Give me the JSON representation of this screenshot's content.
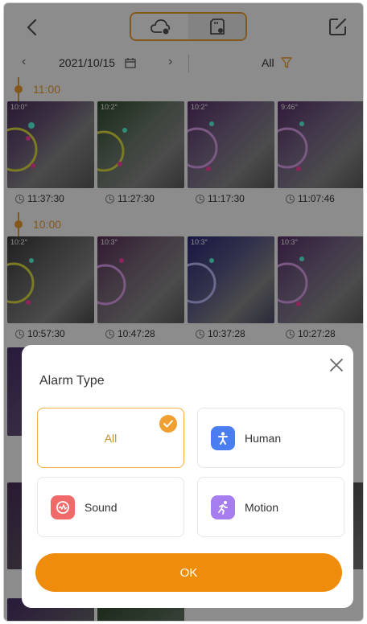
{
  "header": {
    "back_icon": "chevron-left-icon",
    "tabs": [
      {
        "icon": "cloud-storage-icon",
        "active": true
      },
      {
        "icon": "sd-card-icon",
        "active": false
      }
    ],
    "edit_icon": "edit-icon"
  },
  "datebar": {
    "prev": "‹",
    "date": "2021/10/15",
    "next": "›",
    "filter_label": "All"
  },
  "groups": [
    {
      "hour": "11:00",
      "items": [
        {
          "overlay": "10:0°",
          "time": "11:37:30"
        },
        {
          "overlay": "10:2°",
          "time": "11:27:30"
        },
        {
          "overlay": "10:2°",
          "time": "11:17:30"
        },
        {
          "overlay": "9:46°",
          "time": "11:07:46"
        }
      ]
    },
    {
      "hour": "10:00",
      "items": [
        {
          "overlay": "10:2°",
          "time": "10:57:30"
        },
        {
          "overlay": "10:3°",
          "time": "10:47:28"
        },
        {
          "overlay": "10:3°",
          "time": "10:37:28"
        },
        {
          "overlay": "10:3°",
          "time": "10:27:28"
        }
      ]
    }
  ],
  "dialog": {
    "title": "Alarm Type",
    "options": [
      {
        "label": "All",
        "selected": true
      },
      {
        "label": "Human",
        "icon": "person-icon",
        "color": "#4a7ef0"
      },
      {
        "label": "Sound",
        "icon": "sound-icon",
        "color": "#f06a6a"
      },
      {
        "label": "Motion",
        "icon": "running-icon",
        "color": "#a77ef0"
      }
    ],
    "ok_label": "OK"
  },
  "colors": {
    "accent": "#f0a030",
    "button": "#f08c0c"
  }
}
